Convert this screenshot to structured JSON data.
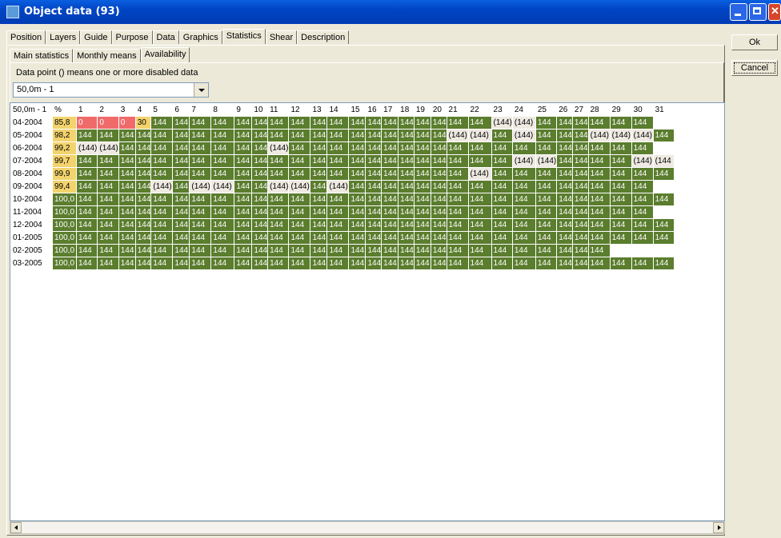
{
  "window": {
    "title": "Object data   (93)"
  },
  "main_tabs": [
    "Position",
    "Layers",
    "Guide",
    "Purpose",
    "Data",
    "Graphics",
    "Statistics",
    "Shear",
    "Description"
  ],
  "main_tabs_active": "Statistics",
  "sub_tabs": [
    "Main statistics",
    "Monthly means",
    "Availability"
  ],
  "sub_tabs_active": "Availability",
  "note": "Data point () means one or more disabled data",
  "combo": {
    "value": "50,0m - 1"
  },
  "buttons": {
    "ok": "Ok",
    "cancel": "Cancel"
  },
  "colors": {
    "ok": "#5b7d2e",
    "disabled": "#eeeae2",
    "zero": "#f06a6a",
    "partial": "#f3d36d"
  },
  "table": {
    "corner": "50,0m - 1",
    "pct_header": "%",
    "days": [
      "1",
      "2",
      "3",
      "4",
      "5",
      "6",
      "7",
      "8",
      "9",
      "10",
      "11",
      "12",
      "13",
      "14",
      "15",
      "16",
      "17",
      "18",
      "19",
      "20",
      "21",
      "22",
      "23",
      "24",
      "25",
      "26",
      "27",
      "28",
      "29",
      "30",
      "31"
    ],
    "rows": [
      {
        "label": "04-2004",
        "pct": "85,8",
        "cells": [
          "0",
          "0",
          "0",
          "30",
          "144",
          "144",
          "144",
          "144",
          "144",
          "144",
          "144",
          "144",
          "144",
          "144",
          "144",
          "144",
          "144",
          "144",
          "144",
          "144",
          "144",
          "144",
          "(144)",
          "(144)",
          "144",
          "144",
          "144",
          "144",
          "144",
          "144",
          ""
        ]
      },
      {
        "label": "05-2004",
        "pct": "98,2",
        "cells": [
          "144",
          "144",
          "144",
          "144",
          "144",
          "144",
          "144",
          "144",
          "144",
          "144",
          "144",
          "144",
          "144",
          "144",
          "144",
          "144",
          "144",
          "144",
          "144",
          "144",
          "(144)",
          "(144)",
          "144",
          "(144)",
          "144",
          "144",
          "144",
          "(144)",
          "(144)",
          "(144)",
          "144"
        ]
      },
      {
        "label": "06-2004",
        "pct": "99,2",
        "cells": [
          "(144)",
          "(144)",
          "144",
          "144",
          "144",
          "144",
          "144",
          "144",
          "144",
          "144",
          "(144)",
          "144",
          "144",
          "144",
          "144",
          "144",
          "144",
          "144",
          "144",
          "144",
          "144",
          "144",
          "144",
          "144",
          "144",
          "144",
          "144",
          "144",
          "144",
          "144",
          ""
        ]
      },
      {
        "label": "07-2004",
        "pct": "99,7",
        "cells": [
          "144",
          "144",
          "144",
          "144",
          "144",
          "144",
          "144",
          "144",
          "144",
          "144",
          "144",
          "144",
          "144",
          "144",
          "144",
          "144",
          "144",
          "144",
          "144",
          "144",
          "144",
          "144",
          "144",
          "(144)",
          "(144)",
          "144",
          "144",
          "144",
          "144",
          "(144)",
          "(144"
        ]
      },
      {
        "label": "08-2004",
        "pct": "99,9",
        "cells": [
          "144",
          "144",
          "144",
          "144",
          "144",
          "144",
          "144",
          "144",
          "144",
          "144",
          "144",
          "144",
          "144",
          "144",
          "144",
          "144",
          "144",
          "144",
          "144",
          "144",
          "144",
          "(144)",
          "144",
          "144",
          "144",
          "144",
          "144",
          "144",
          "144",
          "144",
          "144"
        ]
      },
      {
        "label": "09-2004",
        "pct": "99,4",
        "cells": [
          "144",
          "144",
          "144",
          "144",
          "(144)",
          "144",
          "(144)",
          "(144)",
          "144",
          "144",
          "(144)",
          "(144)",
          "144",
          "(144)",
          "144",
          "144",
          "144",
          "144",
          "144",
          "144",
          "144",
          "144",
          "144",
          "144",
          "144",
          "144",
          "144",
          "144",
          "144",
          "144",
          ""
        ]
      },
      {
        "label": "10-2004",
        "pct": "100,0",
        "cells": [
          "144",
          "144",
          "144",
          "144",
          "144",
          "144",
          "144",
          "144",
          "144",
          "144",
          "144",
          "144",
          "144",
          "144",
          "144",
          "144",
          "144",
          "144",
          "144",
          "144",
          "144",
          "144",
          "144",
          "144",
          "144",
          "144",
          "144",
          "144",
          "144",
          "144",
          "144"
        ]
      },
      {
        "label": "11-2004",
        "pct": "100,0",
        "cells": [
          "144",
          "144",
          "144",
          "144",
          "144",
          "144",
          "144",
          "144",
          "144",
          "144",
          "144",
          "144",
          "144",
          "144",
          "144",
          "144",
          "144",
          "144",
          "144",
          "144",
          "144",
          "144",
          "144",
          "144",
          "144",
          "144",
          "144",
          "144",
          "144",
          "144",
          ""
        ]
      },
      {
        "label": "12-2004",
        "pct": "100,0",
        "cells": [
          "144",
          "144",
          "144",
          "144",
          "144",
          "144",
          "144",
          "144",
          "144",
          "144",
          "144",
          "144",
          "144",
          "144",
          "144",
          "144",
          "144",
          "144",
          "144",
          "144",
          "144",
          "144",
          "144",
          "144",
          "144",
          "144",
          "144",
          "144",
          "144",
          "144",
          "144"
        ]
      },
      {
        "label": "01-2005",
        "pct": "100,0",
        "cells": [
          "144",
          "144",
          "144",
          "144",
          "144",
          "144",
          "144",
          "144",
          "144",
          "144",
          "144",
          "144",
          "144",
          "144",
          "144",
          "144",
          "144",
          "144",
          "144",
          "144",
          "144",
          "144",
          "144",
          "144",
          "144",
          "144",
          "144",
          "144",
          "144",
          "144",
          "144"
        ]
      },
      {
        "label": "02-2005",
        "pct": "100,0",
        "cells": [
          "144",
          "144",
          "144",
          "144",
          "144",
          "144",
          "144",
          "144",
          "144",
          "144",
          "144",
          "144",
          "144",
          "144",
          "144",
          "144",
          "144",
          "144",
          "144",
          "144",
          "144",
          "144",
          "144",
          "144",
          "144",
          "144",
          "144",
          "144",
          "",
          "",
          ""
        ]
      },
      {
        "label": "03-2005",
        "pct": "100,0",
        "cells": [
          "144",
          "144",
          "144",
          "144",
          "144",
          "144",
          "144",
          "144",
          "144",
          "144",
          "144",
          "144",
          "144",
          "144",
          "144",
          "144",
          "144",
          "144",
          "144",
          "144",
          "144",
          "144",
          "144",
          "144",
          "144",
          "144",
          "144",
          "144",
          "144",
          "144",
          "144"
        ]
      }
    ]
  }
}
